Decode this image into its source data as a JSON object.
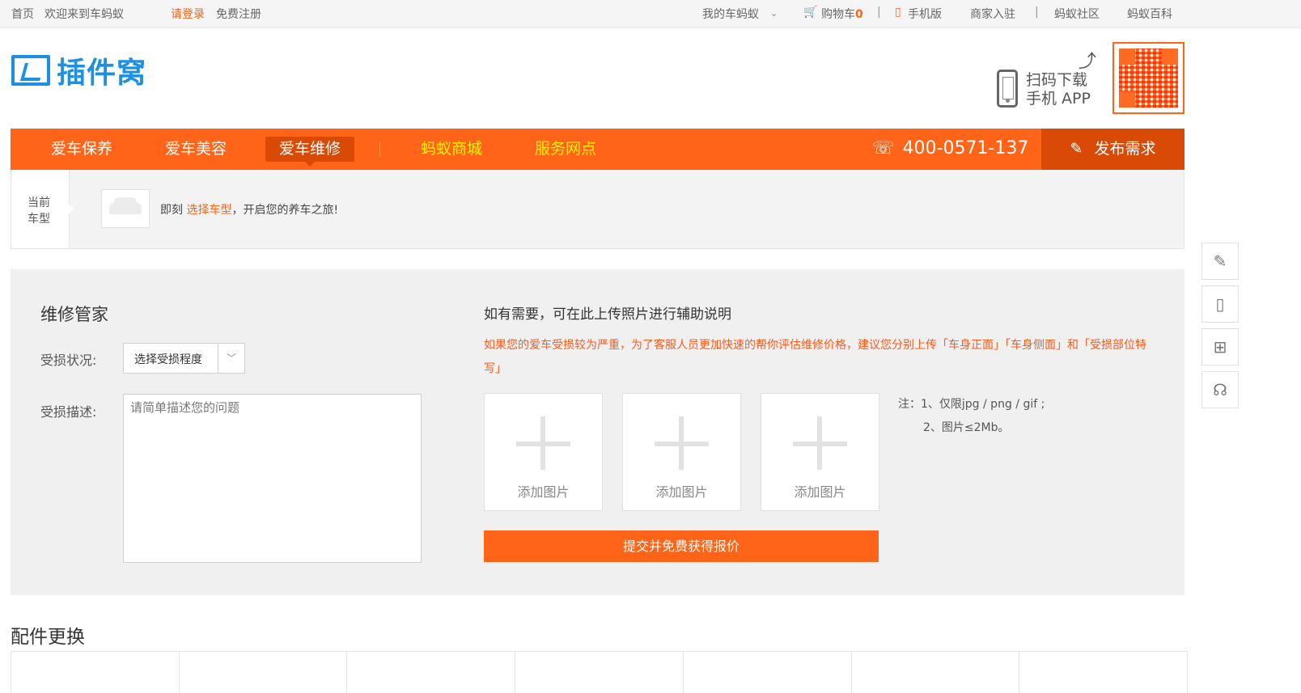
{
  "topbar": {
    "home": "首页",
    "welcome": "欢迎来到车蚂蚁",
    "login": "请登录",
    "register": "免费注册",
    "my_account": "我的车蚂蚁",
    "cart_label": "购物车",
    "cart_count": "0",
    "mobile": "手机版",
    "merchant": "商家入驻",
    "community": "蚂蚁社区",
    "wiki": "蚂蚁百科"
  },
  "header": {
    "logo_text": "插件窝",
    "scan_line1": "扫码下载",
    "scan_line2": "手机 APP"
  },
  "nav": {
    "items": [
      {
        "label": "爱车保养"
      },
      {
        "label": "爱车美容"
      },
      {
        "label": "爱车维修"
      },
      {
        "label": "蚂蚁商城"
      },
      {
        "label": "服务网点"
      }
    ],
    "phone": "400-0571-137",
    "publish": "发布需求"
  },
  "car": {
    "label_line1": "当前",
    "label_line2": "车型",
    "text_before": "即刻 ",
    "text_link": "选择车型",
    "text_after": "，开启您的养车之旅!"
  },
  "repair": {
    "title": "维修管家",
    "damage_label": "受损状况:",
    "damage_select": "选择受损程度",
    "desc_label": "受损描述:",
    "desc_placeholder": "请简单描述您的问题",
    "upload_title": "如有需要，可在此上传照片进行辅助说明",
    "upload_tip": "如果您的爱车受损较为严重，为了客服人员更加快速的帮你评估维修价格，建议您分别上传「车身正面」「车身侧面」和「受损部位特写」",
    "upload_boxes": [
      {
        "label": "添加图片"
      },
      {
        "label": "添加图片"
      },
      {
        "label": "添加图片"
      }
    ],
    "note_line1": "注：1、仅限jpg / png / gif ;",
    "note_line2": "2、图片≤2Mb。",
    "submit": "提交并免费获得报价"
  },
  "parts": {
    "title": "配件更换"
  }
}
